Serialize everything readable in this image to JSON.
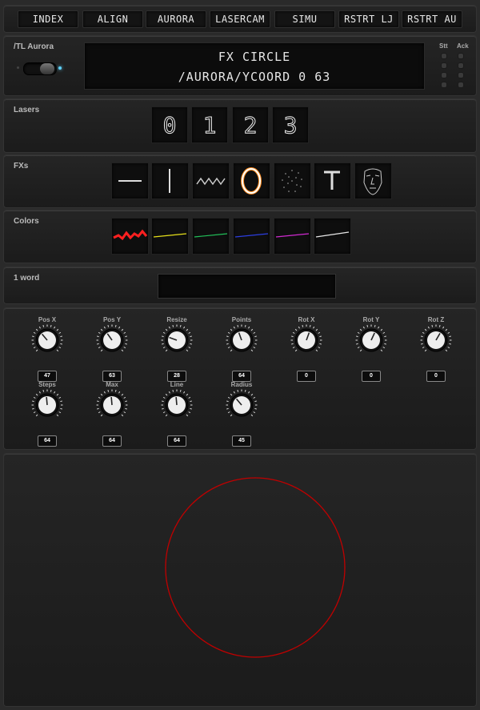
{
  "nav": {
    "buttons": [
      "INDEX",
      "ALIGN",
      "AURORA",
      "LASERCAM",
      "SIMU",
      "RSTRT LJ",
      "RSTRT AU"
    ]
  },
  "aurora": {
    "label": "/TL Aurora",
    "display_line1": "FX CIRCLE",
    "display_line2": "/AURORA/YCOORD 0 63",
    "stt_label": "Stt",
    "ack_label": "Ack"
  },
  "lasers": {
    "label": "Lasers",
    "items": [
      "0",
      "1",
      "2",
      "3"
    ]
  },
  "fxs": {
    "label": "FXs",
    "icons": [
      "horizontal-line-icon",
      "vertical-line-icon",
      "zigzag-icon",
      "circle-icon",
      "dots-cloud-icon",
      "letter-t-icon",
      "face-icon"
    ]
  },
  "colors": {
    "label": "Colors",
    "swatches": [
      "#ff2020",
      "#e6e01a",
      "#22c25a",
      "#2c3ee0",
      "#d12ad1",
      "#e8e8e8"
    ]
  },
  "word": {
    "label": "1 word",
    "value": ""
  },
  "knobs": {
    "row1": [
      {
        "label": "Pos X",
        "value": "47"
      },
      {
        "label": "Pos Y",
        "value": "63"
      },
      {
        "label": "Resize",
        "value": "28"
      },
      {
        "label": "Points",
        "value": "64"
      },
      {
        "label": "Rot X",
        "value": "0"
      },
      {
        "label": "Rot Y",
        "value": "0"
      },
      {
        "label": "Rot Z",
        "value": "0"
      }
    ],
    "row2": [
      {
        "label": "Steps",
        "value": "64"
      },
      {
        "label": "Max",
        "value": "64"
      },
      {
        "label": "Line",
        "value": "64"
      },
      {
        "label": "Radius",
        "value": "45"
      }
    ]
  },
  "preview": {
    "shape": "circle",
    "color": "#c00000"
  }
}
